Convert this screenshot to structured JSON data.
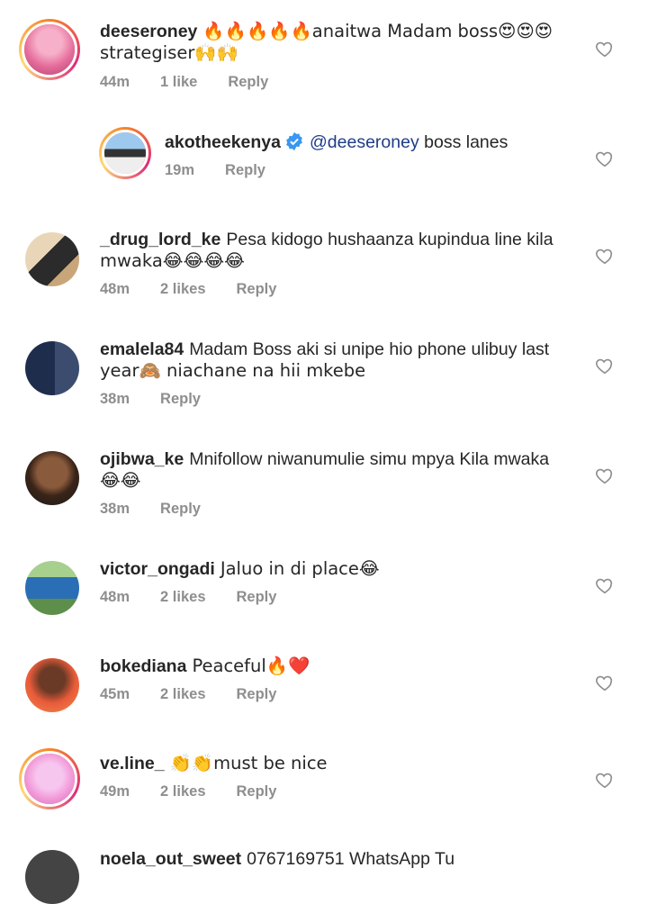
{
  "comments": [
    {
      "username": "deeseroney",
      "text": "🔥🔥🔥🔥🔥anaitwa Madam boss😍😍😍",
      "text2": "strategiser🙌🙌",
      "time": "44m",
      "likes": "1 like",
      "reply": "Reply",
      "avatar_color": "#e46b9a"
    },
    {
      "username": "akotheekenya",
      "mention": "@deeseroney",
      "text": "boss lanes",
      "time": "19m",
      "reply": "Reply",
      "avatar_color": "#7fb7e8",
      "verified_color": "#3897f0"
    },
    {
      "username": "_drug_lord_ke",
      "text": "Pesa kidogo hushaanza kupindua line kila",
      "text2": "mwaka😂😂😂😂",
      "time": "48m",
      "likes": "2 likes",
      "reply": "Reply",
      "avatar_color": "#d2b48c"
    },
    {
      "username": "emalela84",
      "text": "Madam Boss aki si unipe hio phone ulibuy last",
      "text2": "year🙈 niachane na hii mkebe",
      "time": "38m",
      "reply": "Reply",
      "avatar_color": "#2f3f63"
    },
    {
      "username": "ojibwa_ke",
      "text": "Mnifollow niwanumulie simu mpya Kila mwaka",
      "text2": "😂😂",
      "time": "38m",
      "reply": "Reply",
      "avatar_color": "#5a3a2a"
    },
    {
      "username": "victor_ongadi",
      "text": "Jaluo in di place😂",
      "time": "48m",
      "likes": "2 likes",
      "reply": "Reply",
      "avatar_color": "#6fa864"
    },
    {
      "username": "bokediana",
      "text": "Peaceful🔥❤️",
      "time": "45m",
      "likes": "2 likes",
      "reply": "Reply",
      "avatar_color": "#e85b3a"
    },
    {
      "username": "ve.line_",
      "text": "👏👏must be nice",
      "time": "49m",
      "likes": "2 likes",
      "reply": "Reply",
      "avatar_color": "#f29ad8"
    },
    {
      "username": "noela_out_sweet",
      "text": "0767169751 WhatsApp Tu",
      "avatar_color": "#444444"
    }
  ]
}
